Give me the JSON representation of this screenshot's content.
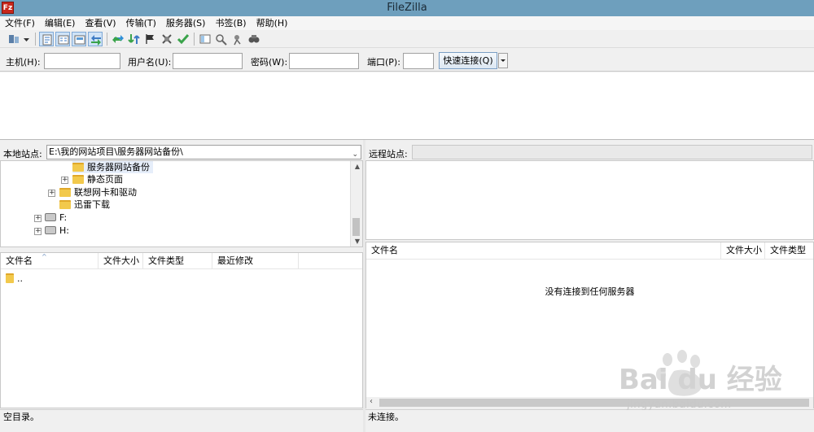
{
  "window": {
    "title": "FileZilla",
    "icon_label": "Fz"
  },
  "menu": [
    "文件(F)",
    "编辑(E)",
    "查看(V)",
    "传输(T)",
    "服务器(S)",
    "书签(B)",
    "帮助(H)"
  ],
  "toolbar_icons": [
    "site-manager-icon",
    "dropdown-arrow-icon",
    "toggle-message-log-icon",
    "toggle-local-tree-icon",
    "toggle-remote-tree-icon",
    "toggle-queue-icon",
    "refresh-icon",
    "process-queue-icon",
    "cancel-operation-icon",
    "disconnect-icon",
    "reconnect-icon",
    "directory-filter-icon",
    "compare-directories-icon",
    "sync-browsing-icon",
    "search-remote-icon"
  ],
  "quickconnect": {
    "host_label": "主机(H):",
    "user_label": "用户名(U):",
    "pass_label": "密码(W):",
    "port_label": "端口(P):",
    "host_value": "",
    "user_value": "",
    "pass_value": "",
    "port_value": "",
    "connect_label": "快速连接(Q)"
  },
  "local": {
    "site_label": "本地站点:",
    "path": "E:\\我的网站项目\\服务器网站备份\\",
    "tree": [
      {
        "label": "服务器网站备份",
        "kind": "folder",
        "selected": true
      },
      {
        "label": "静态页面",
        "kind": "folder",
        "expandable": true
      },
      {
        "label": "联想网卡和驱动",
        "kind": "folder",
        "expandable": true
      },
      {
        "label": "迅雷下载",
        "kind": "folder"
      },
      {
        "label": "F:",
        "kind": "drive",
        "expandable": true
      },
      {
        "label": "H:",
        "kind": "drive",
        "expandable": true
      }
    ],
    "columns": [
      "文件名",
      "文件大小",
      "文件类型",
      "最近修改"
    ],
    "rows": [
      {
        "name": ".."
      }
    ],
    "status": "空目录。"
  },
  "remote": {
    "site_label": "远程站点:",
    "path": "",
    "columns": [
      "文件名",
      "文件大小",
      "文件类型"
    ],
    "empty_message": "没有连接到任何服务器",
    "status": "未连接。"
  },
  "watermark": {
    "logo_text": "Bai du 经验",
    "url": "jingyan.baidu.com"
  }
}
